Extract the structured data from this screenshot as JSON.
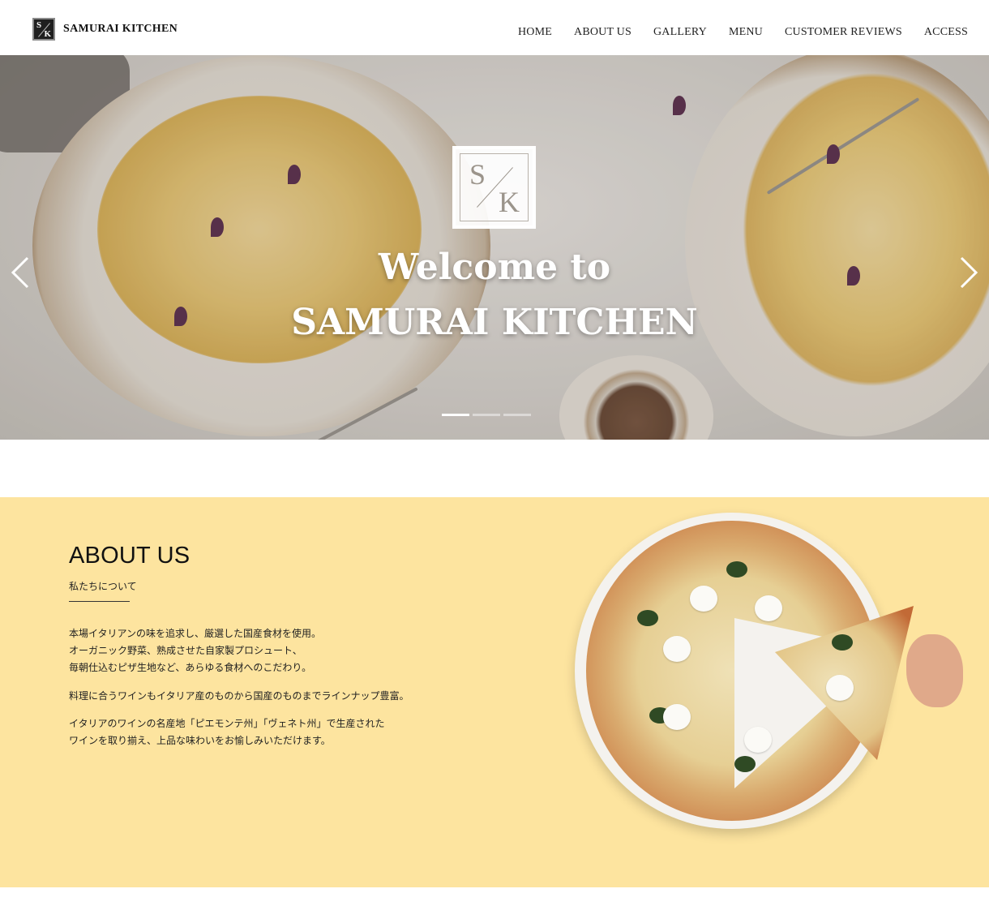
{
  "header": {
    "logo_s": "S",
    "logo_k": "K",
    "brand": "SAMURAI KITCHEN",
    "nav": [
      "HOME",
      "ABOUT US",
      "GALLERY",
      "MENU",
      "CUSTOMER REVIEWS",
      "ACCESS"
    ]
  },
  "hero": {
    "logo_s": "S",
    "logo_k": "K",
    "title_line1": "Welcome to",
    "title_line2": "SAMURAI KITCHEN",
    "slide_count": 3,
    "active_slide": 1
  },
  "about": {
    "heading": "ABOUT US",
    "subheading": "私たちについて",
    "paragraph1": [
      "本場イタリアンの味を追求し、厳選した国産食材を使用。",
      "オーガニック野菜、熟成させた自家製プロシュート、",
      "毎朝仕込むピザ生地など、あらゆる食材へのこだわり。"
    ],
    "paragraph2": [
      "料理に合うワインもイタリア産のものから国産のものまでラインナップ豊富。"
    ],
    "paragraph3": [
      "イタリアのワインの名産地「ピエモンテ州」「ヴェネト州」で生産された",
      "ワインを取り揃え、上品な味わいをお愉しみいただけます。"
    ]
  },
  "colors": {
    "about_bg": "#fde49f",
    "header_bg": "#ffffff",
    "text": "#222222"
  },
  "icons": {
    "prev": "chevron-left-icon",
    "next": "chevron-right-icon"
  }
}
